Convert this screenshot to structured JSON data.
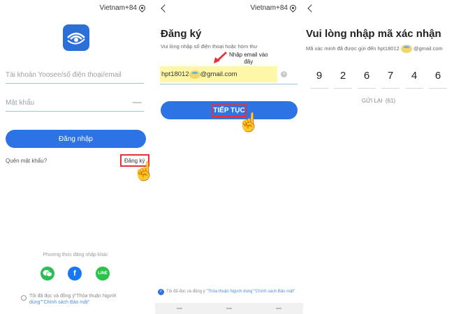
{
  "screen1": {
    "region": "Vietnam+84",
    "account_placeholder": "Tài khoản Yoosee/số điện thoại/email",
    "password_placeholder": "Mật khẩu",
    "eye_glyph": "~~~",
    "login_button": "Đăng nhập",
    "forgot_password": "Quên mật khẩu?",
    "register_link": "Đăng ký",
    "other_methods": "Phương thức đăng nhập khác",
    "social": [
      "wechat",
      "facebook",
      "line"
    ],
    "line_label": "LINE",
    "agreement_line1": "Tôi đã đọc và đồng ý\"Thỏa thuận Người",
    "agreement_line2": "dùng\"\"Chính sách Bảo mật\""
  },
  "screen2": {
    "region": "Vietnam+84",
    "title": "Đăng ký",
    "subtitle": "Vui lòng nhập số điện thoại hoặc hòm thư",
    "annotation_line1": "Nhập email vào",
    "annotation_line2": "đây",
    "email_prefix": "hpt18012",
    "email_suffix": "@gmail.com",
    "continue_button": "TIẾP TỤC",
    "agreement_prefix": "Tôi đã đọc và đồng ý",
    "agreement_links": "\"Thỏa thuận Người dùng\"\"Chính sách Bảo mật\""
  },
  "screen3": {
    "title": "Vui lòng nhập mã xác nhận",
    "subtitle_prefix": "Mã xác minh đã được gửi đến hpt18012",
    "subtitle_suffix": "@gmail.com",
    "digits": [
      "9",
      "2",
      "6",
      "7",
      "4",
      "6"
    ],
    "resend": "GỬI LẠI  (61)"
  },
  "colors": {
    "accent": "#2e73e5",
    "highlight_box": "#e53238",
    "email_highlight": "#fff7a8"
  }
}
